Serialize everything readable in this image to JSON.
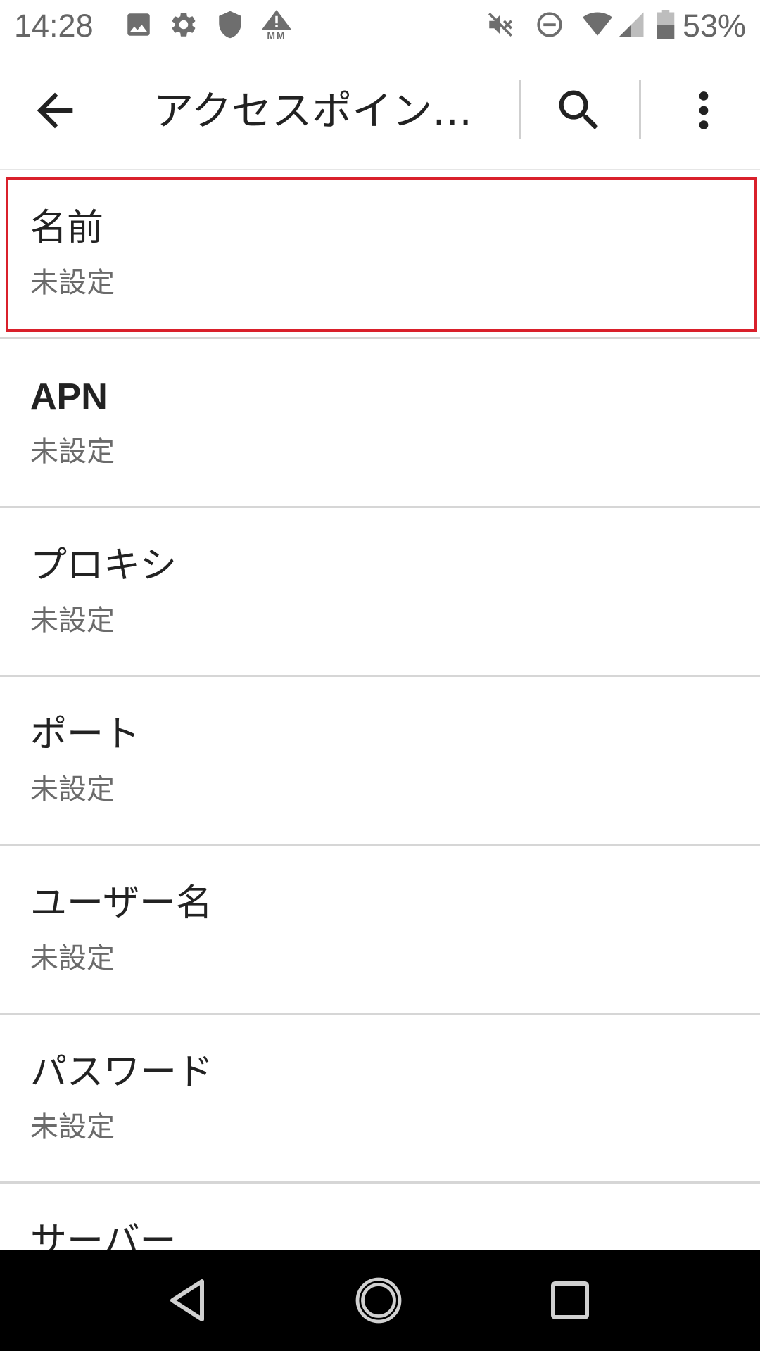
{
  "status_bar": {
    "time": "14:28",
    "battery_percent": "53%",
    "icons": [
      "image-icon",
      "gear-icon",
      "shield-icon",
      "warning-mm-icon",
      "mute-icon",
      "do-not-disturb-icon",
      "wifi-icon",
      "signal-icon",
      "battery-icon"
    ],
    "warning_badge_text": "MM"
  },
  "app_bar": {
    "title": "アクセスポイン…",
    "back_icon": "arrow-back-icon",
    "search_icon": "search-icon",
    "more_icon": "more-vert-icon"
  },
  "list": {
    "items": [
      {
        "title": "名前",
        "summary": "未設定"
      },
      {
        "title": "APN",
        "summary": "未設定"
      },
      {
        "title": "プロキシ",
        "summary": "未設定"
      },
      {
        "title": "ポート",
        "summary": "未設定"
      },
      {
        "title": "ユーザー名",
        "summary": "未設定"
      },
      {
        "title": "パスワード",
        "summary": "未設定"
      },
      {
        "title": "サーバー",
        "summary": ""
      }
    ]
  },
  "highlight": {
    "color": "#d9202b",
    "target": "名前"
  },
  "nav_bar": {
    "icons": [
      "nav-back-icon",
      "nav-home-icon",
      "nav-recents-icon"
    ]
  }
}
